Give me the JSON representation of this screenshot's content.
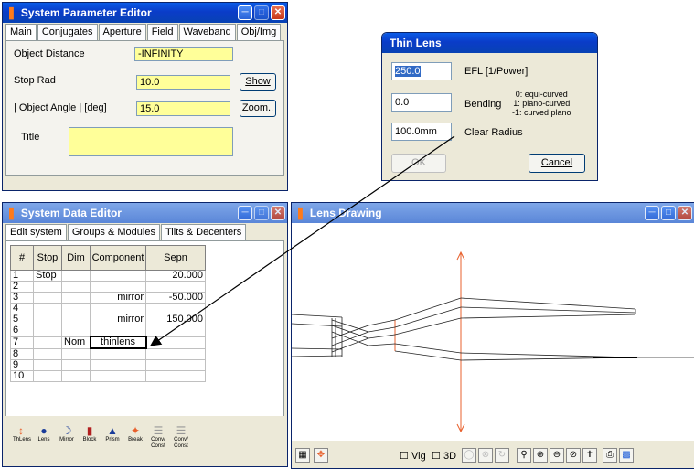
{
  "spe": {
    "title": "System Parameter Editor",
    "tabs": [
      "Main",
      "Conjugates",
      "Aperture",
      "Field",
      "Waveband",
      "Obj/Img"
    ],
    "object_distance_label": "Object Distance",
    "object_distance_value": "-INFINITY",
    "stop_rad_label": "Stop Rad",
    "stop_rad_value": "10.0",
    "show_label": "Show",
    "object_angle_label": "| Object Angle |  [deg]",
    "object_angle_value": "15.0",
    "zoom_label": "Zoom..",
    "title_label": "Title",
    "title_value": ""
  },
  "thin_lens": {
    "title": "Thin Lens",
    "efl_value": "250.0",
    "efl_label": "EFL [1/Power]",
    "bending_value": "0.0",
    "bending_label": "Bending",
    "bending_options": [
      "0: equi-curved",
      "1: plano-curved",
      "-1: curved plano"
    ],
    "clear_radius_value": "100.0mm",
    "clear_radius_label": "Clear Radius",
    "ok_label": "OK",
    "cancel_label": "Cancel"
  },
  "sde": {
    "title": "System Data Editor",
    "tabs": [
      "Edit system",
      "Groups & Modules",
      "Tilts & Decenters"
    ],
    "columns": [
      "#",
      "Stop",
      "Dim",
      "Component",
      "Sepn"
    ],
    "rows": [
      {
        "num": "1",
        "stop": "Stop",
        "dim": "",
        "component": "",
        "sepn": "20.000"
      },
      {
        "num": "2",
        "stop": "",
        "dim": "",
        "component": "",
        "sepn": ""
      },
      {
        "num": "3",
        "stop": "",
        "dim": "",
        "component": "mirror",
        "sepn": "-50.000"
      },
      {
        "num": "4",
        "stop": "",
        "dim": "",
        "component": "",
        "sepn": ""
      },
      {
        "num": "5",
        "stop": "",
        "dim": "",
        "component": "mirror",
        "sepn": "150.000"
      },
      {
        "num": "6",
        "stop": "",
        "dim": "",
        "component": "",
        "sepn": ""
      },
      {
        "num": "7",
        "stop": "",
        "dim": "Nom",
        "component": "thinlens",
        "sepn": ""
      },
      {
        "num": "8",
        "stop": "",
        "dim": "",
        "component": "",
        "sepn": ""
      },
      {
        "num": "9",
        "stop": "",
        "dim": "",
        "component": "",
        "sepn": ""
      },
      {
        "num": "10",
        "stop": "",
        "dim": "",
        "component": "",
        "sepn": ""
      }
    ],
    "toolbar": [
      {
        "label": "ThLens",
        "icon": "thin-lens-icon"
      },
      {
        "label": "Lens",
        "icon": "lens-icon"
      },
      {
        "label": "Mirror",
        "icon": "mirror-icon"
      },
      {
        "label": "Block",
        "icon": "block-icon"
      },
      {
        "label": "Prism",
        "icon": "prism-icon"
      },
      {
        "label": "Break",
        "icon": "break-icon"
      },
      {
        "label": "Conv/ Const",
        "icon": "conv-icon"
      },
      {
        "label": "Conv/ Const",
        "icon": "const-icon"
      }
    ]
  },
  "lens_drawing": {
    "title": "Lens Drawing",
    "vig_label": "Vig",
    "threed_label": "3D"
  },
  "colors": {
    "title_bar": "#0a46d2",
    "field_yellow": "#ffff99",
    "lens_line": "#e8602c",
    "window_bg": "#ece9d8"
  }
}
